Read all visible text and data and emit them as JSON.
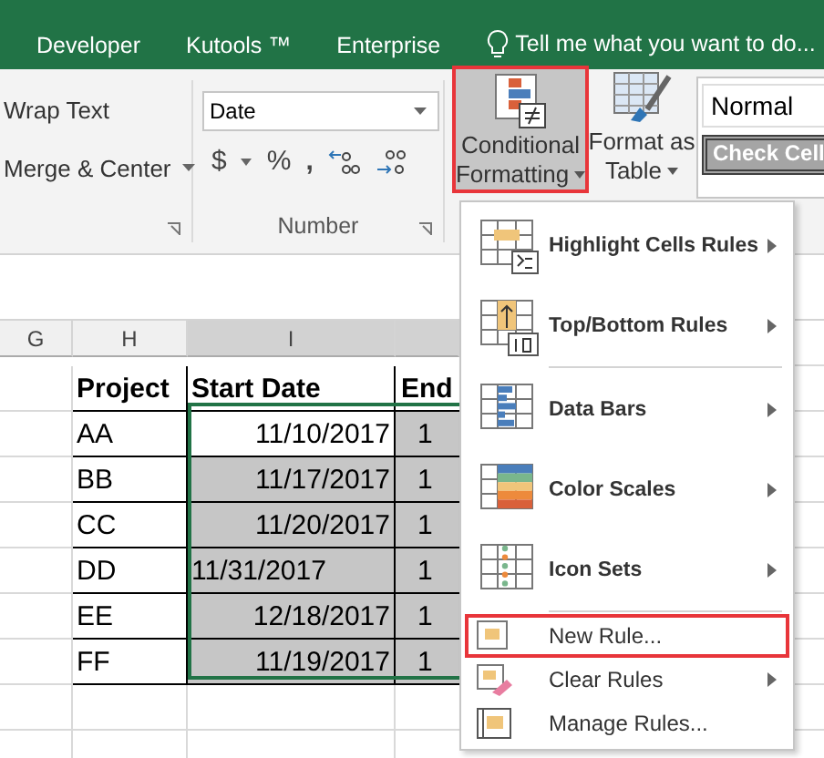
{
  "tabs": [
    {
      "label": "Developer"
    },
    {
      "label": "Kutools ™"
    },
    {
      "label": "Enterprise"
    }
  ],
  "tell_me": {
    "placeholder": "Tell me what you want to do..."
  },
  "alignment": {
    "wrap_text": "Wrap Text",
    "merge_center": "Merge & Center"
  },
  "number": {
    "format": "Date",
    "currency": "$",
    "percent": "%",
    "comma": ",",
    "label": "Number"
  },
  "styles": {
    "conditional_formatting": [
      "Conditional",
      "Formatting"
    ],
    "format_as_table": [
      "Format as",
      "Table"
    ],
    "normal": "Normal",
    "check_cell": "Check Cell"
  },
  "columns": [
    {
      "label": "G",
      "selected": false
    },
    {
      "label": "H",
      "selected": false
    },
    {
      "label": "I",
      "selected": true
    }
  ],
  "rows": [
    {
      "project": "Project",
      "start": "Start Date",
      "end": "End",
      "kind": "header"
    },
    {
      "project": "AA",
      "start": "11/10/2017",
      "end": "1",
      "kind": "date",
      "active": true
    },
    {
      "project": "BB",
      "start": "11/17/2017",
      "end": "1",
      "kind": "date",
      "active": false
    },
    {
      "project": "CC",
      "start": "11/20/2017",
      "end": "1",
      "kind": "date",
      "active": false
    },
    {
      "project": "DD",
      "start": "11/31/2017",
      "end": "1",
      "kind": "text",
      "active": false
    },
    {
      "project": "EE",
      "start": "12/18/2017",
      "end": "1",
      "kind": "date",
      "active": false
    },
    {
      "project": "FF",
      "start": "11/19/2017",
      "end": "1",
      "kind": "date",
      "active": false
    }
  ],
  "menu": [
    {
      "label": "Highlight Cells Rules",
      "kind": "large",
      "submenu": true,
      "outlined": false
    },
    {
      "label": "Top/Bottom Rules",
      "kind": "large",
      "submenu": true,
      "outlined": false
    },
    {
      "kind": "divider"
    },
    {
      "label": "Data Bars",
      "kind": "large",
      "submenu": true,
      "outlined": false
    },
    {
      "label": "Color Scales",
      "kind": "large",
      "submenu": true,
      "outlined": false
    },
    {
      "label": "Icon Sets",
      "kind": "large",
      "submenu": true,
      "outlined": false
    },
    {
      "kind": "divider"
    },
    {
      "label": "New Rule...",
      "kind": "small",
      "submenu": false,
      "outlined": true
    },
    {
      "label": "Clear Rules",
      "kind": "small",
      "submenu": true,
      "outlined": false
    },
    {
      "label": "Manage Rules...",
      "kind": "small",
      "submenu": false,
      "outlined": false
    }
  ]
}
